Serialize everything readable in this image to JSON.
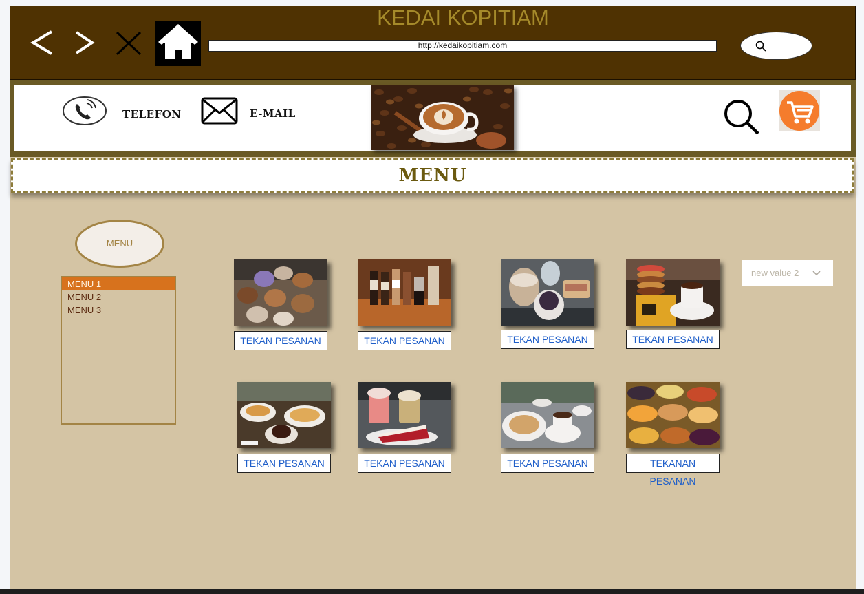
{
  "header": {
    "site_title": "KEDAI KOPITIAM",
    "url": "http://kedaikopitiam.com",
    "back_icon": "chevron-left-icon",
    "forward_icon": "chevron-right-icon",
    "close_icon": "close-icon",
    "home_icon": "home-icon",
    "search_icon": "search-icon"
  },
  "contact": {
    "phone_label": "TELEFON",
    "email_label": "E-MAIL",
    "phone_icon": "phone-icon",
    "email_icon": "envelope-icon",
    "search_icon": "search-icon",
    "cart_icon": "cart-icon",
    "cart_color": "#f57c2c"
  },
  "banner": {
    "title": "MENU"
  },
  "sidebar": {
    "menu_button": "MENU",
    "items": [
      {
        "label": "MENU 1",
        "active": true
      },
      {
        "label": "MENU 2",
        "active": false
      },
      {
        "label": "MENU 3",
        "active": false
      }
    ]
  },
  "products": [
    {
      "photo": "iced coffee cups",
      "button": "TEKAN PESANAN"
    },
    {
      "photo": "bottled coffee drinks",
      "button": "TEKAN PESANAN"
    },
    {
      "photo": "iced drinks and sandwich",
      "button": "TEKAN PESANAN"
    },
    {
      "photo": "stacked cookies with coffee",
      "button": "TEKAN PESANAN"
    },
    {
      "photo": "coffee with pastries",
      "button": "TEKAN PESANAN"
    },
    {
      "photo": "red velvet cake and drinks",
      "button": "TEKAN PESANAN"
    },
    {
      "photo": "toast with coffee",
      "button": "TEKAN PESANAN"
    },
    {
      "photo": "assorted cheesecakes",
      "button": "TEKANAN PESANAN"
    }
  ],
  "dropdown": {
    "selected": "new value 2",
    "icon": "chevron-down-icon"
  }
}
